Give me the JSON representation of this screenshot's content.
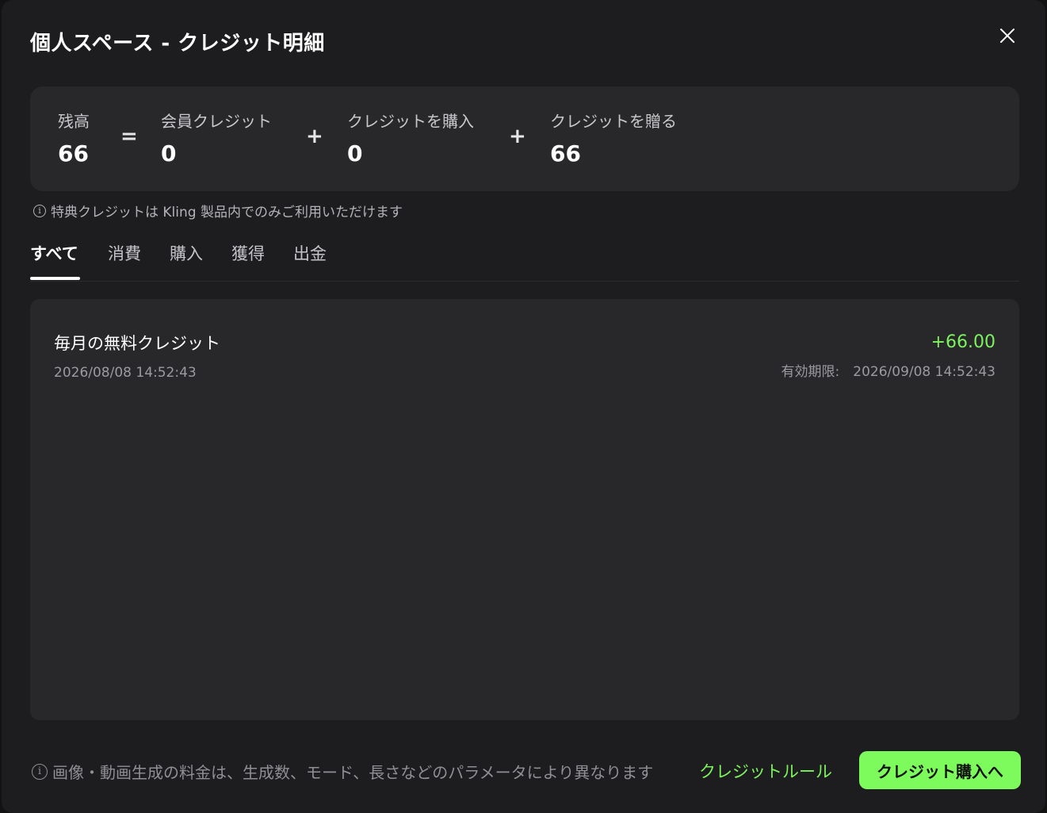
{
  "dialog": {
    "title": "個人スペース - クレジット明細",
    "close_icon": "close-icon"
  },
  "summary": {
    "balance": {
      "label": "残高",
      "value": "66"
    },
    "op_equals": "=",
    "membership": {
      "label": "会員クレジット",
      "value": "0"
    },
    "op_plus_1": "+",
    "purchased": {
      "label": "クレジットを購入",
      "value": "0"
    },
    "op_plus_2": "+",
    "gifted": {
      "label": "クレジットを贈る",
      "value": "66"
    }
  },
  "notice": {
    "icon": "info-icon",
    "text": "特典クレジットは Kling 製品内でのみご利用いただけます"
  },
  "tabs": [
    {
      "label": "すべて",
      "active": true
    },
    {
      "label": "消費",
      "active": false
    },
    {
      "label": "購入",
      "active": false
    },
    {
      "label": "獲得",
      "active": false
    },
    {
      "label": "出金",
      "active": false
    }
  ],
  "records": [
    {
      "title": "毎月の無料クレジット",
      "date": "2026/08/08 14:52:43",
      "amount": "+66.00",
      "expiry": "有効期限:　2026/09/08 14:52:43"
    }
  ],
  "footer": {
    "icon": "info-icon",
    "note": "画像・動画生成の料金は、生成数、モード、長さなどのパラメータにより異なります",
    "rules_link": "クレジットルール",
    "buy_button": "クレジット購入へ"
  },
  "colors": {
    "accent_green": "#7dfb5c",
    "dialog_bg": "#1d1d1f",
    "panel_bg": "#28282b"
  }
}
